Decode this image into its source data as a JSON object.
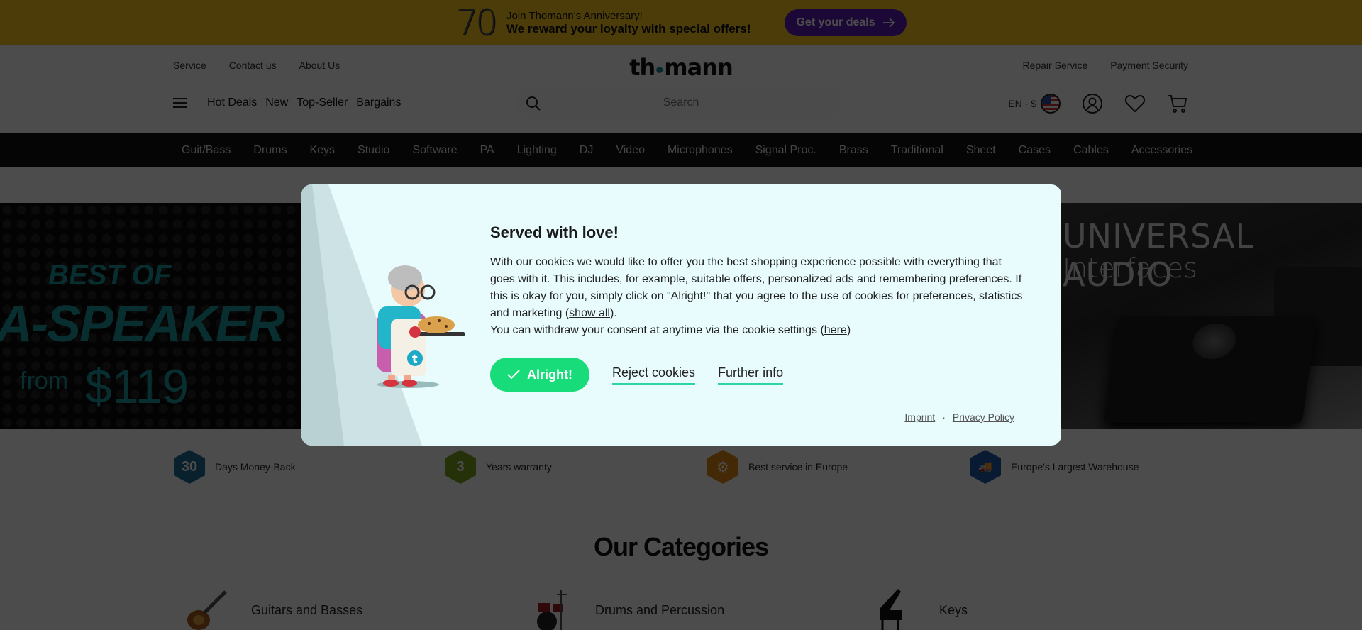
{
  "promo": {
    "badge": "70",
    "line1": "Join Thomann's Anniversary!",
    "line2": "We reward your loyalty with special offers!",
    "cta_label": "Get your deals",
    "cta_icon": "arrow-right-icon"
  },
  "header": {
    "logo": {
      "left": "th",
      "right": "mann"
    },
    "top_links_left": [
      "Service",
      "Contact us",
      "About Us"
    ],
    "top_links_right": [
      "Repair Service",
      "Payment Security"
    ],
    "main_links": [
      "Hot Deals",
      "New",
      "Top-Seller",
      "Bargains"
    ],
    "search": {
      "placeholder": "Search",
      "value": ""
    },
    "locale": "EN · $",
    "icons": [
      "flag-us-icon",
      "account-icon",
      "wishlist-heart-icon",
      "cart-icon"
    ]
  },
  "category_bar": [
    "Guit/Bass",
    "Drums",
    "Keys",
    "Studio",
    "Software",
    "PA",
    "Lighting",
    "DJ",
    "Video",
    "Microphones",
    "Signal Proc.",
    "Brass",
    "Traditional",
    "Sheet",
    "Cases",
    "Cables",
    "Accessories"
  ],
  "hero_left": {
    "line1": "BEST OF",
    "line2": "A-SPEAKER",
    "from": "from",
    "price": "$119"
  },
  "hero_right": {
    "line1": "UNIVERSAL AUDIO",
    "line2": "Interfaces"
  },
  "features": [
    {
      "badge": "30",
      "label": "Days Money-Back",
      "color": "#1e6e93"
    },
    {
      "badge": "3",
      "label": "Years warranty",
      "color": "#7aa321"
    },
    {
      "badge": "⚙",
      "label": "Best service in Europe",
      "color": "#e08a12"
    },
    {
      "badge": "🚚",
      "label": "Europe's Largest Warehouse",
      "color": "#1f5aa8"
    }
  ],
  "categories": {
    "title": "Our Categories",
    "items": [
      "Guitars and Basses",
      "Drums and Percussion",
      "Keys"
    ]
  },
  "cookie_modal": {
    "title": "Served with love!",
    "body_p1": "With our cookies we would like to offer you the best shopping experience possible with everything that goes with it. This includes, for example, suitable offers, personalized ads and remembering preferences. If this is okay for you, simply click on \"Alright!\" that you agree to the use of cookies for preferences, statistics and marketing (",
    "show_all": "show all",
    "body_p1_end": ").",
    "body_p2": "You can withdraw your consent at anytime via the cookie settings (",
    "here": "here",
    "body_p2_end": ")",
    "accept_label": "Alright!",
    "reject_label": "Reject cookies",
    "info_label": "Further info",
    "imprint": "Imprint",
    "separator": "·",
    "privacy": "Privacy Policy",
    "accent": "#18db7a"
  }
}
